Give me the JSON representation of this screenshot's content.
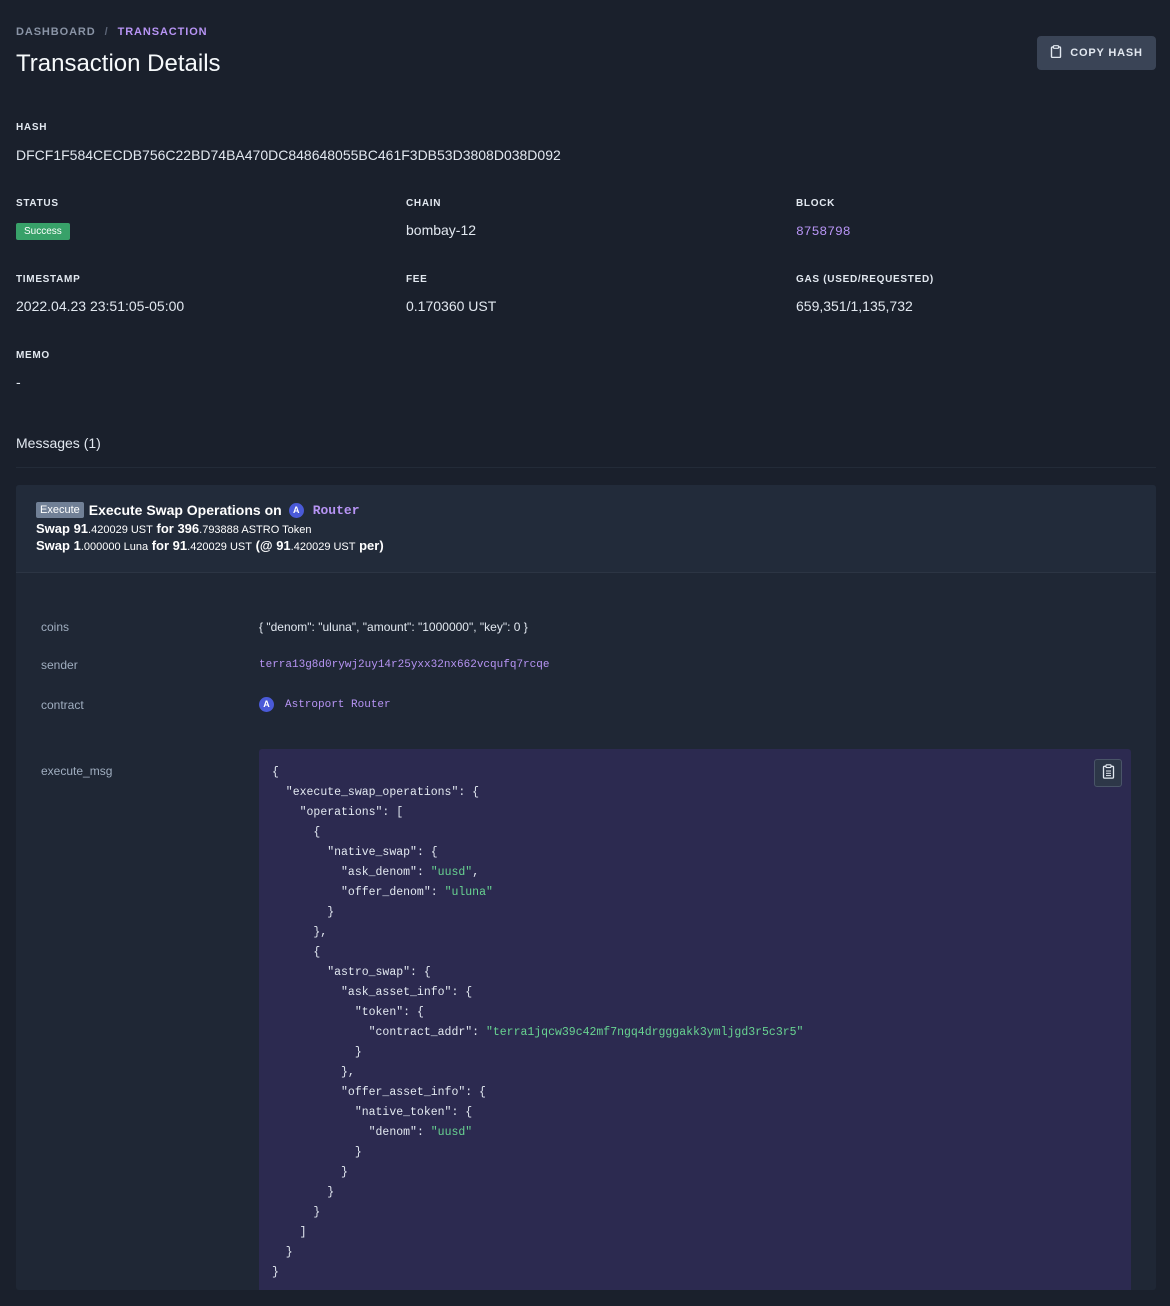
{
  "breadcrumb": {
    "home": "DASHBOARD",
    "separator": "/",
    "current": "TRANSACTION"
  },
  "header": {
    "title": "Transaction Details",
    "copy_label": "COPY HASH",
    "copy_icon": "clipboard-icon"
  },
  "hash": {
    "label": "HASH",
    "value": "DFCF1F584CECDB756C22BD74BA470DC848648055BC461F3DB53D3808D038D092"
  },
  "status": {
    "label": "STATUS",
    "value": "Success",
    "color": "#38a169"
  },
  "chain": {
    "label": "CHAIN",
    "value": "bombay-12"
  },
  "block": {
    "label": "BLOCK",
    "value": "8758798"
  },
  "timestamp": {
    "label": "TIMESTAMP",
    "value": "2022.04.23 23:51:05-05:00"
  },
  "fee": {
    "label": "FEE",
    "value": "0.170360 UST"
  },
  "gas": {
    "label": "GAS (USED/REQUESTED)",
    "value": "659,351/1,135,732"
  },
  "memo": {
    "label": "MEMO",
    "value": "-"
  },
  "messages": {
    "title": "Messages (1)",
    "items": [
      {
        "badge": "Execute",
        "title": "Execute Swap Operations on",
        "contract_short": "Router",
        "swap1": {
          "p1": "Swap ",
          "a_int": "91",
          "a_dec": ".420029 UST",
          "p2": " for ",
          "b_int": "396",
          "b_dec": ".793888 ASTRO Token"
        },
        "swap2": {
          "p1": "Swap ",
          "a_int": "1",
          "a_dec": ".000000 Luna",
          "p2": " for ",
          "b_int": "91",
          "b_dec": ".420029 UST",
          "p3": " (@ ",
          "c_int": "91",
          "c_dec": ".420029 UST",
          "p4": "  per)"
        },
        "fields": {
          "coins_key": "coins",
          "coins_val": "{ \"denom\": \"uluna\", \"amount\": \"1000000\", \"key\": 0 }",
          "sender_key": "sender",
          "sender_val": "terra13g8d0rywj2uy14r25yxx32nx662vcqufq7rcqe",
          "contract_key": "contract",
          "contract_val": "Astroport Router",
          "exec_key": "execute_msg"
        },
        "execute_msg": {
          "fn": "execute_swap_operations",
          "operations_key": "operations",
          "native_swap_key": "native_swap",
          "ask_denom_key": "ask_denom",
          "ask_denom_val": "uusd",
          "offer_denom_key": "offer_denom",
          "offer_denom_val": "uluna",
          "astro_swap_key": "astro_swap",
          "ask_asset_info_key": "ask_asset_info",
          "token_key": "token",
          "contract_addr_key": "contract_addr",
          "contract_addr_val": "terra1jqcw39c42mf7ngq4drgggakk3ymljgd3r5c3r5",
          "offer_asset_info_key": "offer_asset_info",
          "native_token_key": "native_token",
          "denom_key": "denom",
          "denom_val": "uusd"
        }
      }
    ]
  }
}
